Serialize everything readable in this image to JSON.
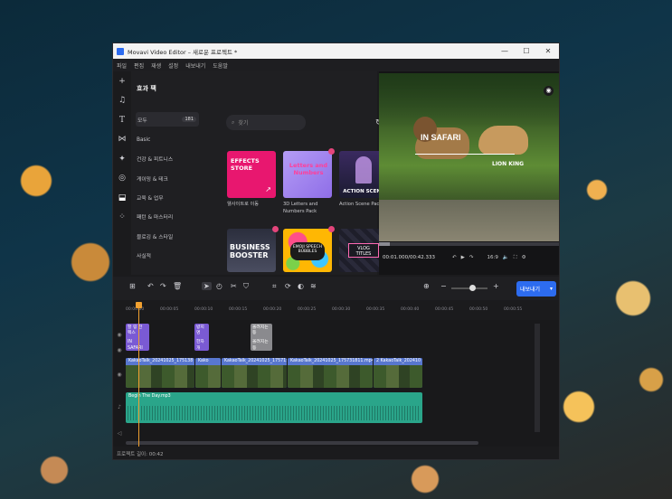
{
  "window": {
    "title": "Movavi Video Editor – 새로운 프로젝트 *",
    "min": "—",
    "max": "☐",
    "close": "✕"
  },
  "menu": [
    "파일",
    "편집",
    "재생",
    "설정",
    "내보내기",
    "도움말"
  ],
  "rail_icons": [
    "plus-icon",
    "music-icon",
    "text-icon",
    "transitions-icon",
    "sparkle-icon",
    "circle-icon",
    "stickers-icon",
    "filters-icon"
  ],
  "panel": {
    "title": "효과 팩",
    "categories": [
      {
        "label": "모두",
        "count": "181"
      },
      {
        "label": "Basic"
      },
      {
        "label": "건강 & 피트니스"
      },
      {
        "label": "게이밍 & 테크"
      },
      {
        "label": "교육 & 업무"
      },
      {
        "label": "패턴 & 마스터리"
      },
      {
        "label": "블로깅 & 스타일"
      },
      {
        "label": "사실적"
      }
    ],
    "search_placeholder": "찾기",
    "tiles": [
      {
        "thumb_text": "EFFECTS STORE",
        "caption": "웰사이트로 이동",
        "color": "#e8176f"
      },
      {
        "thumb_text": "Letters and Numbers",
        "caption": "3D Letters and Numbers Pack",
        "color": "#a88cf0"
      },
      {
        "thumb_text": "ACTION SCENE",
        "caption": "Action Scene Pack",
        "color": "#2a2a44"
      },
      {
        "thumb_text": "BUSINESS BOOSTER",
        "caption": "",
        "color": "#3a3d50"
      },
      {
        "thumb_text": "EMOJI SPEECH BUBBLES",
        "caption": "",
        "color": "#ffb703"
      },
      {
        "thumb_text": "VLOG TITLES",
        "caption": "",
        "color": "#1e1e2a"
      }
    ]
  },
  "preview": {
    "title1": "IN SAFARI",
    "title2": "LION KING",
    "timecode": "00:01.000/00:42.333",
    "aspect": "16:9"
  },
  "toolbar": {
    "export_label": "내보내기"
  },
  "ruler": [
    "00:00:00",
    "00:00:05",
    "00:00:10",
    "00:00:15",
    "00:00:20",
    "00:00:25",
    "00:00:30",
    "00:00:35",
    "00:00:40",
    "00:00:45",
    "00:00:50",
    "00:00:55"
  ],
  "timeline": {
    "title_clips": [
      {
        "label": "할 링 한 펙스",
        "sub": "IN SAFARI"
      },
      {
        "label": "방지 명",
        "sub": "한자 개"
      },
      {
        "label": "올려지는 등",
        "sub": "올려지는 등"
      }
    ],
    "video_clips": [
      "KakaoTalk_20241025_175138",
      "Kako",
      "KakaoTalk_20241025_175715232_0",
      "KakaoTalk_20241025_175731811.mp4",
      "2 KakaoTalk_202410"
    ],
    "audio_clip": "Begin The Day.mp3"
  },
  "status": {
    "duration": "프로젝트 길이: 00:42"
  }
}
